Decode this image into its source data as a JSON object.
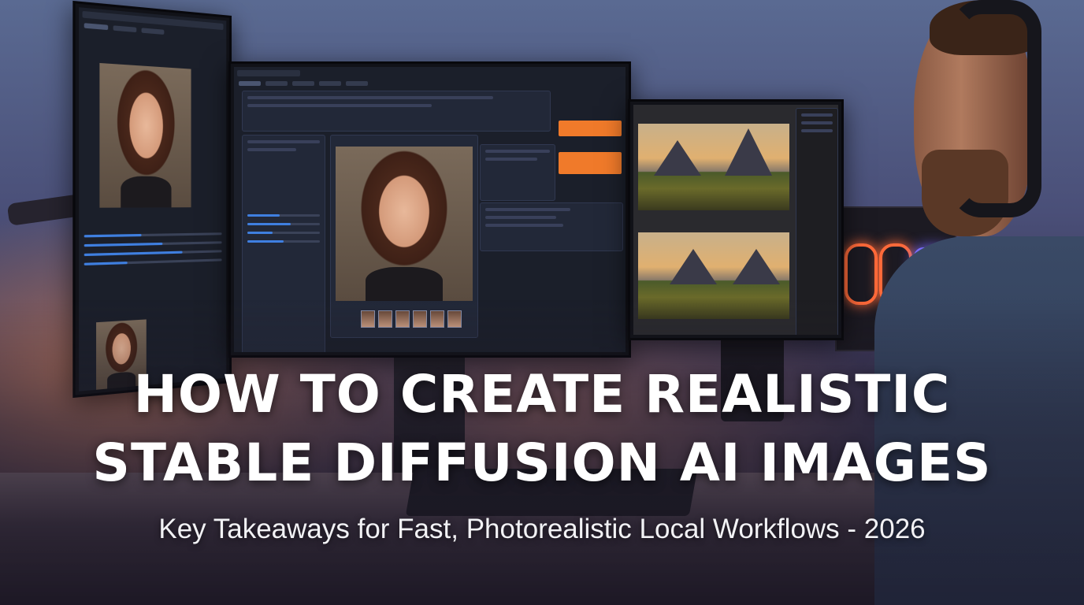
{
  "headline": {
    "line1": "HOW TO CREATE REALISTIC",
    "line2": "STABLE DIFFUSION AI IMAGES"
  },
  "subtitle": "Key Takeaways for Fast, Photorealistic Local Workflows - 2026",
  "colors": {
    "accent_orange": "#f07a2a",
    "slider_blue": "#3f7fe0",
    "ui_background": "#1b1f2a",
    "text": "#ffffff"
  },
  "icons": [
    "portrait-image",
    "landscape-image",
    "pc-fan-light"
  ]
}
